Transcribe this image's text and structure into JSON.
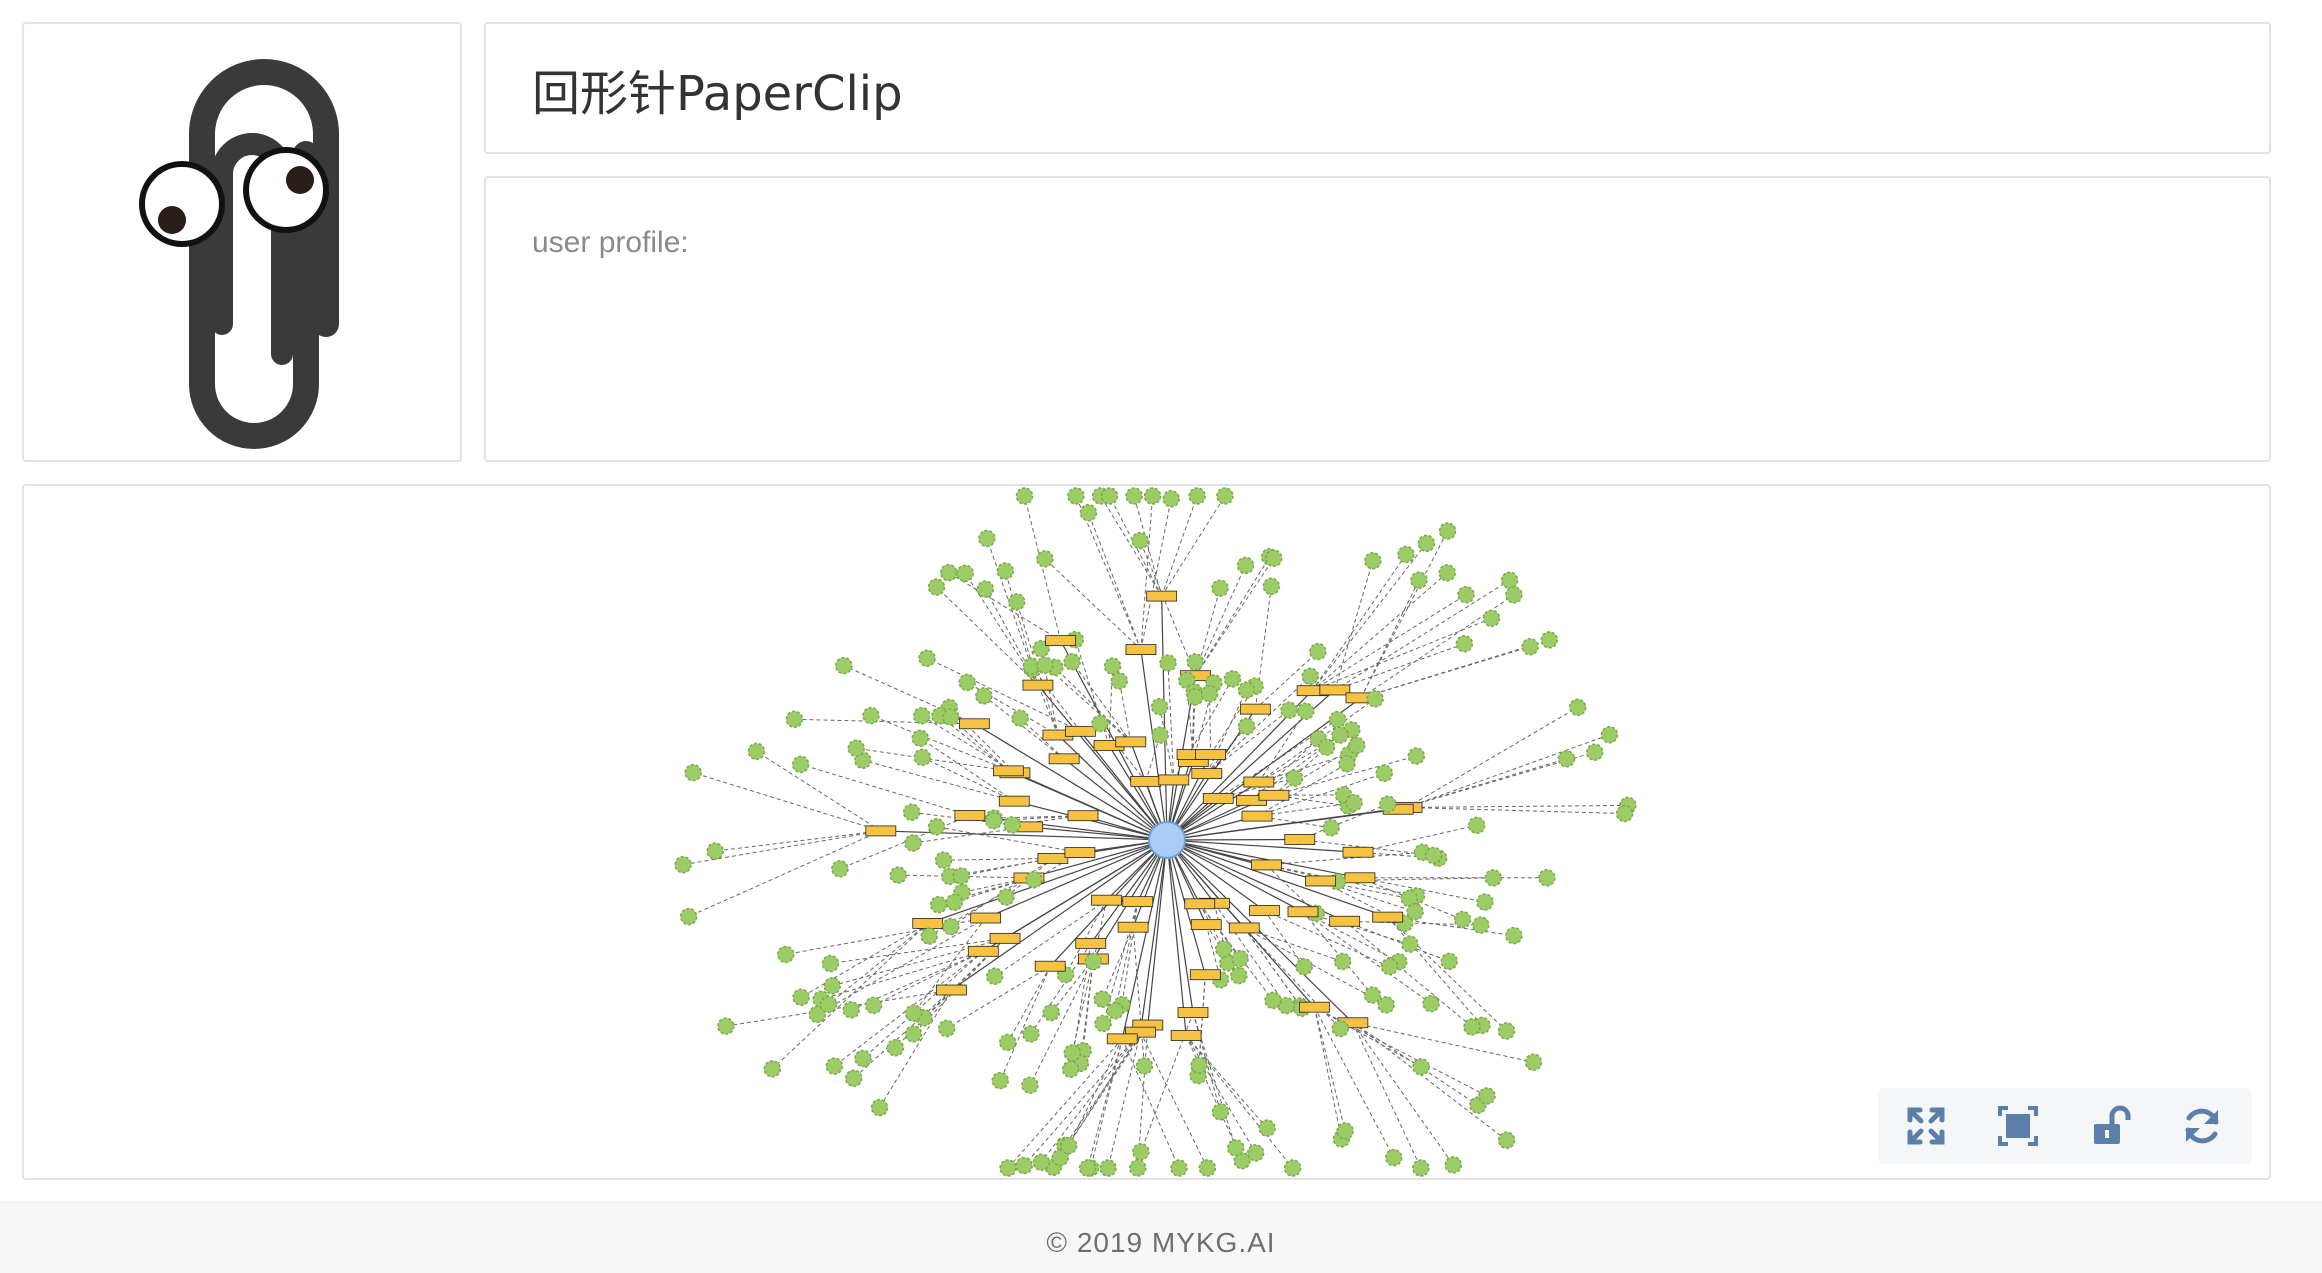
{
  "app": {
    "title": "回形针PaperClip",
    "logo_icon": "paperclip-with-eyes-icon"
  },
  "profile": {
    "label": "user profile:"
  },
  "graph": {
    "center_node_color": "#a9cdf5",
    "hub_node_color": "#f5c242",
    "leaf_node_color": "#9ccc65",
    "edge_style": "dashed"
  },
  "controls": [
    {
      "name": "fullscreen-icon"
    },
    {
      "name": "fit-view-icon"
    },
    {
      "name": "unlock-icon"
    },
    {
      "name": "refresh-icon"
    }
  ],
  "footer": {
    "text": "© 2019 MYKG.AI"
  }
}
